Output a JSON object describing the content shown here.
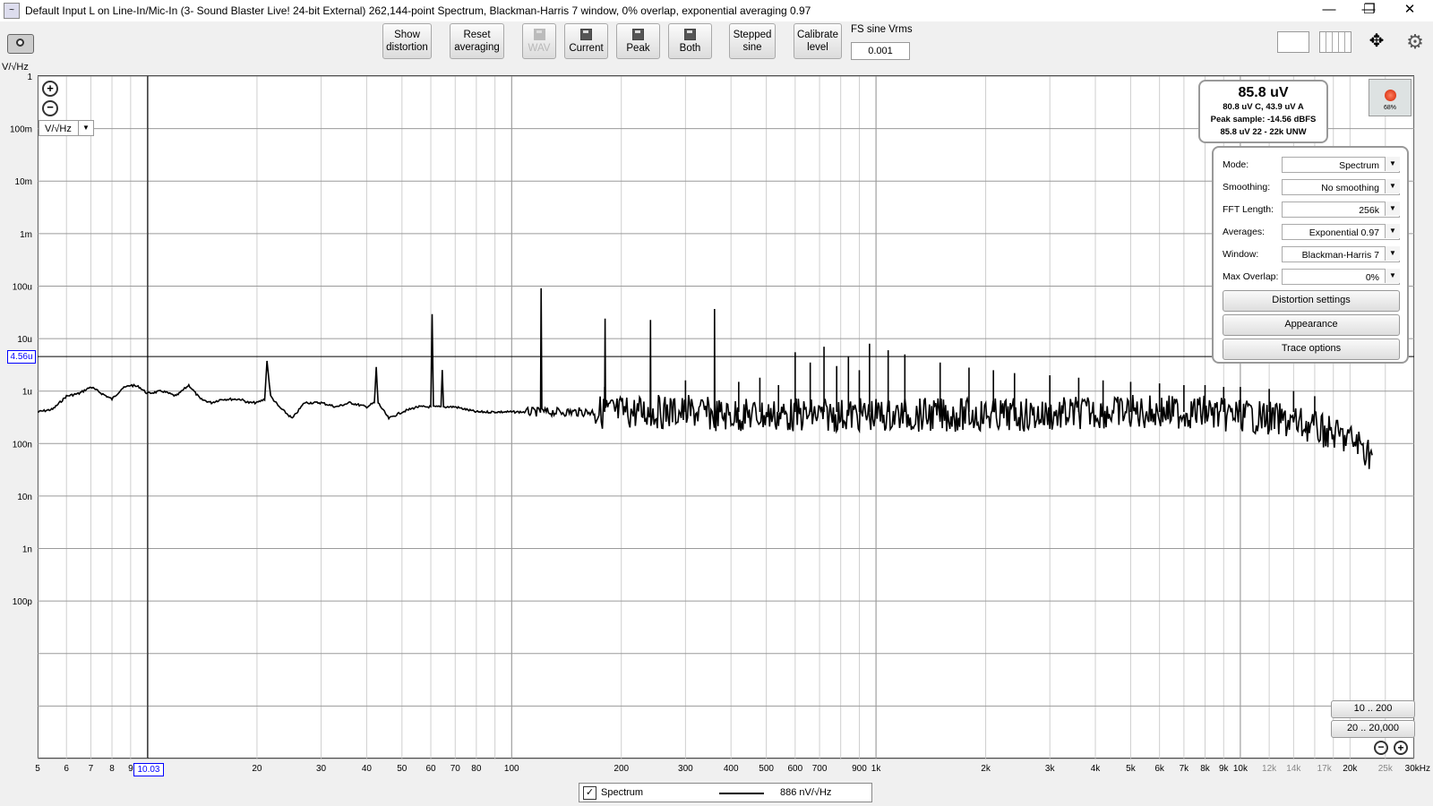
{
  "window": {
    "title": "Default Input L on Line-In/Mic-In (3- Sound Blaster Live! 24-bit External) 262,144-point Spectrum, Blackman-Harris 7 window, 0% overlap, exponential averaging 0.97",
    "minimize": "—",
    "maximize": "❐",
    "close": "✕"
  },
  "toolbar": {
    "buttons": [
      {
        "line1": "Show",
        "line2": "distortion"
      },
      {
        "line1": "Reset",
        "line2": "averaging"
      },
      {
        "line1": "WAV",
        "line2": ""
      },
      {
        "line1": "Current",
        "line2": ""
      },
      {
        "line1": "Peak",
        "line2": ""
      },
      {
        "line1": "Both",
        "line2": ""
      },
      {
        "line1": "Stepped",
        "line2": "sine"
      },
      {
        "line1": "Calibrate",
        "line2": "level"
      }
    ],
    "fs_label": "FS sine Vrms",
    "fs_value": "0.001"
  },
  "level_box": {
    "main": "85.8 uV",
    "line1": "80.8 uV C, 43.9 uV A",
    "line2": "Peak sample: -14.56 dBFS",
    "line3": "85.8 uV 22 - 22k UNW",
    "meter": "68%"
  },
  "settings": {
    "rows": [
      {
        "label": "Mode:",
        "value": "Spectrum"
      },
      {
        "label": "Smoothing:",
        "value": "No  smoothing"
      },
      {
        "label": "FFT Length:",
        "value": "256k"
      },
      {
        "label": "Averages:",
        "value": "Exponential 0.97"
      },
      {
        "label": "Window:",
        "value": "Blackman-Harris 7"
      },
      {
        "label": "Max Overlap:",
        "value": "0%"
      }
    ],
    "buttons": [
      "Distortion settings",
      "Appearance",
      "Trace options"
    ]
  },
  "zoom": {
    "range1": "10 .. 200",
    "range2": "20 .. 20,000"
  },
  "unit_select": "V/√Hz",
  "legend": {
    "checkbox": "✓",
    "name": "Spectrum",
    "value": "886 nV/√Hz"
  },
  "chart_data": {
    "type": "line",
    "ylabel": "V/√Hz",
    "x_scale": "log",
    "y_scale": "log",
    "xlim": [
      5,
      30000
    ],
    "ylim": [
      1e-13,
      1
    ],
    "y_ticks": [
      "1",
      "100m",
      "10m",
      "1m",
      "100u",
      "10u",
      "1u",
      "100n",
      "10n",
      "1n",
      "100p"
    ],
    "x_ticks": [
      {
        "v": 5,
        "l": "5"
      },
      {
        "v": 6,
        "l": "6"
      },
      {
        "v": 7,
        "l": "7"
      },
      {
        "v": 8,
        "l": "8"
      },
      {
        "v": 9,
        "l": "9"
      },
      {
        "v": 20,
        "l": "20"
      },
      {
        "v": 30,
        "l": "30"
      },
      {
        "v": 40,
        "l": "40"
      },
      {
        "v": 50,
        "l": "50"
      },
      {
        "v": 60,
        "l": "60"
      },
      {
        "v": 70,
        "l": "70"
      },
      {
        "v": 80,
        "l": "80"
      },
      {
        "v": 100,
        "l": "100"
      },
      {
        "v": 200,
        "l": "200"
      },
      {
        "v": 300,
        "l": "300"
      },
      {
        "v": 400,
        "l": "400"
      },
      {
        "v": 500,
        "l": "500"
      },
      {
        "v": 600,
        "l": "600"
      },
      {
        "v": 700,
        "l": "700"
      },
      {
        "v": 900,
        "l": "900"
      },
      {
        "v": 1000,
        "l": "1k"
      },
      {
        "v": 2000,
        "l": "2k"
      },
      {
        "v": 3000,
        "l": "3k"
      },
      {
        "v": 4000,
        "l": "4k"
      },
      {
        "v": 5000,
        "l": "5k"
      },
      {
        "v": 6000,
        "l": "6k"
      },
      {
        "v": 7000,
        "l": "7k"
      },
      {
        "v": 8000,
        "l": "8k"
      },
      {
        "v": 9000,
        "l": "9k"
      },
      {
        "v": 10000,
        "l": "10k"
      },
      {
        "v": 12000,
        "l": "12k"
      },
      {
        "v": 14000,
        "l": "14k"
      },
      {
        "v": 17000,
        "l": "17k"
      },
      {
        "v": 20000,
        "l": "20k"
      },
      {
        "v": 25000,
        "l": "25k"
      },
      {
        "v": 30000,
        "l": "30kHz"
      }
    ],
    "cursor": {
      "x": 10.03,
      "x_label": "10.03",
      "y": 4.56e-06,
      "y_label": "4.56u"
    },
    "grid": true,
    "series": [
      {
        "name": "Spectrum",
        "x": [
          5,
          5.5,
          6,
          6.5,
          7,
          7.5,
          8,
          8.5,
          9,
          9.5,
          10,
          11,
          12,
          13,
          14,
          15,
          16,
          18,
          19,
          20,
          21,
          21.3,
          21.8,
          23,
          25,
          27,
          30,
          33,
          36,
          40,
          42,
          42.5,
          43,
          46,
          50,
          55,
          60,
          60.5,
          61,
          64,
          64.5,
          65,
          70,
          80,
          90,
          100,
          110,
          120,
          120.5,
          121,
          140,
          150,
          170,
          180,
          180.5,
          181,
          200,
          220,
          240,
          240.5,
          241,
          260,
          300,
          320,
          360,
          360.5,
          361,
          400,
          420,
          480,
          500,
          540,
          600,
          660,
          720,
          800,
          840,
          900,
          1000,
          1080,
          1200,
          1500,
          2000,
          3000,
          4000,
          5000,
          6000,
          7000,
          8000,
          9000,
          10000,
          12000,
          14000,
          16000,
          18000,
          20000,
          21000,
          22000,
          23000
        ],
        "values": [
          4e-07,
          4.5e-07,
          8e-07,
          9e-07,
          1.2e-06,
          9e-07,
          7e-07,
          1.1e-06,
          1.3e-06,
          1.2e-06,
          9e-07,
          1e-06,
          8e-07,
          1.3e-06,
          7e-07,
          6e-07,
          7e-07,
          7e-07,
          6e-07,
          6e-07,
          7e-07,
          3.8e-06,
          8e-07,
          5e-07,
          3e-07,
          6e-07,
          6e-07,
          5e-07,
          6e-07,
          5e-07,
          6e-07,
          2.8e-06,
          6e-07,
          3e-07,
          4e-07,
          5e-07,
          5e-07,
          2.8e-05,
          5e-07,
          5e-07,
          2.6e-06,
          5e-07,
          5e-07,
          4e-07,
          4e-07,
          4e-07,
          4e-07,
          4e-07,
          9.5e-05,
          4e-07,
          4e-07,
          4e-07,
          4e-07,
          4e-07,
          2.2e-05,
          4e-07,
          4e-07,
          4e-07,
          4e-07,
          3.3e-05,
          4e-07,
          4e-07,
          4e-07,
          4e-07,
          3.5e-07,
          2.4e-05,
          3.5e-07,
          3.5e-07,
          3.5e-07,
          3.5e-07,
          3.5e-07,
          3.5e-07,
          3.5e-07,
          3.5e-07,
          3.5e-07,
          3.5e-07,
          3.5e-07,
          3.5e-07,
          3.5e-07,
          3.5e-07,
          3.5e-07,
          3.5e-07,
          3.5e-07,
          3.5e-07,
          4e-07,
          4e-07,
          4e-07,
          4e-07,
          4e-07,
          3.5e-07,
          3.5e-07,
          3e-07,
          2.5e-07,
          2e-07,
          1.5e-07,
          1.2e-07,
          1e-07,
          8e-08,
          6e-08
        ]
      }
    ],
    "harmonics": {
      "x": [
        180,
        300,
        420,
        480,
        540,
        600,
        660,
        720,
        780,
        840,
        900,
        960,
        1080,
        1200,
        1500,
        1800,
        2100,
        2400,
        3000,
        3600,
        4200,
        5000,
        6000,
        7000,
        8000,
        9000,
        10000,
        12000,
        14000,
        16000
      ],
      "values": [
        1.2e-06,
        1.6e-06,
        1.5e-06,
        1.8e-06,
        1.3e-06,
        5.5e-06,
        3.5e-06,
        7e-06,
        3e-06,
        4.5e-06,
        2.5e-06,
        8e-06,
        6e-06,
        5e-06,
        3.5e-06,
        2.8e-06,
        2.5e-06,
        2.2e-06,
        2e-06,
        1.8e-06,
        1.6e-06,
        1.5e-06,
        1.4e-06,
        1.3e-06,
        1.3e-06,
        1.2e-06,
        1.2e-06,
        1.1e-06,
        1e-06,
        8e-07
      ]
    }
  }
}
